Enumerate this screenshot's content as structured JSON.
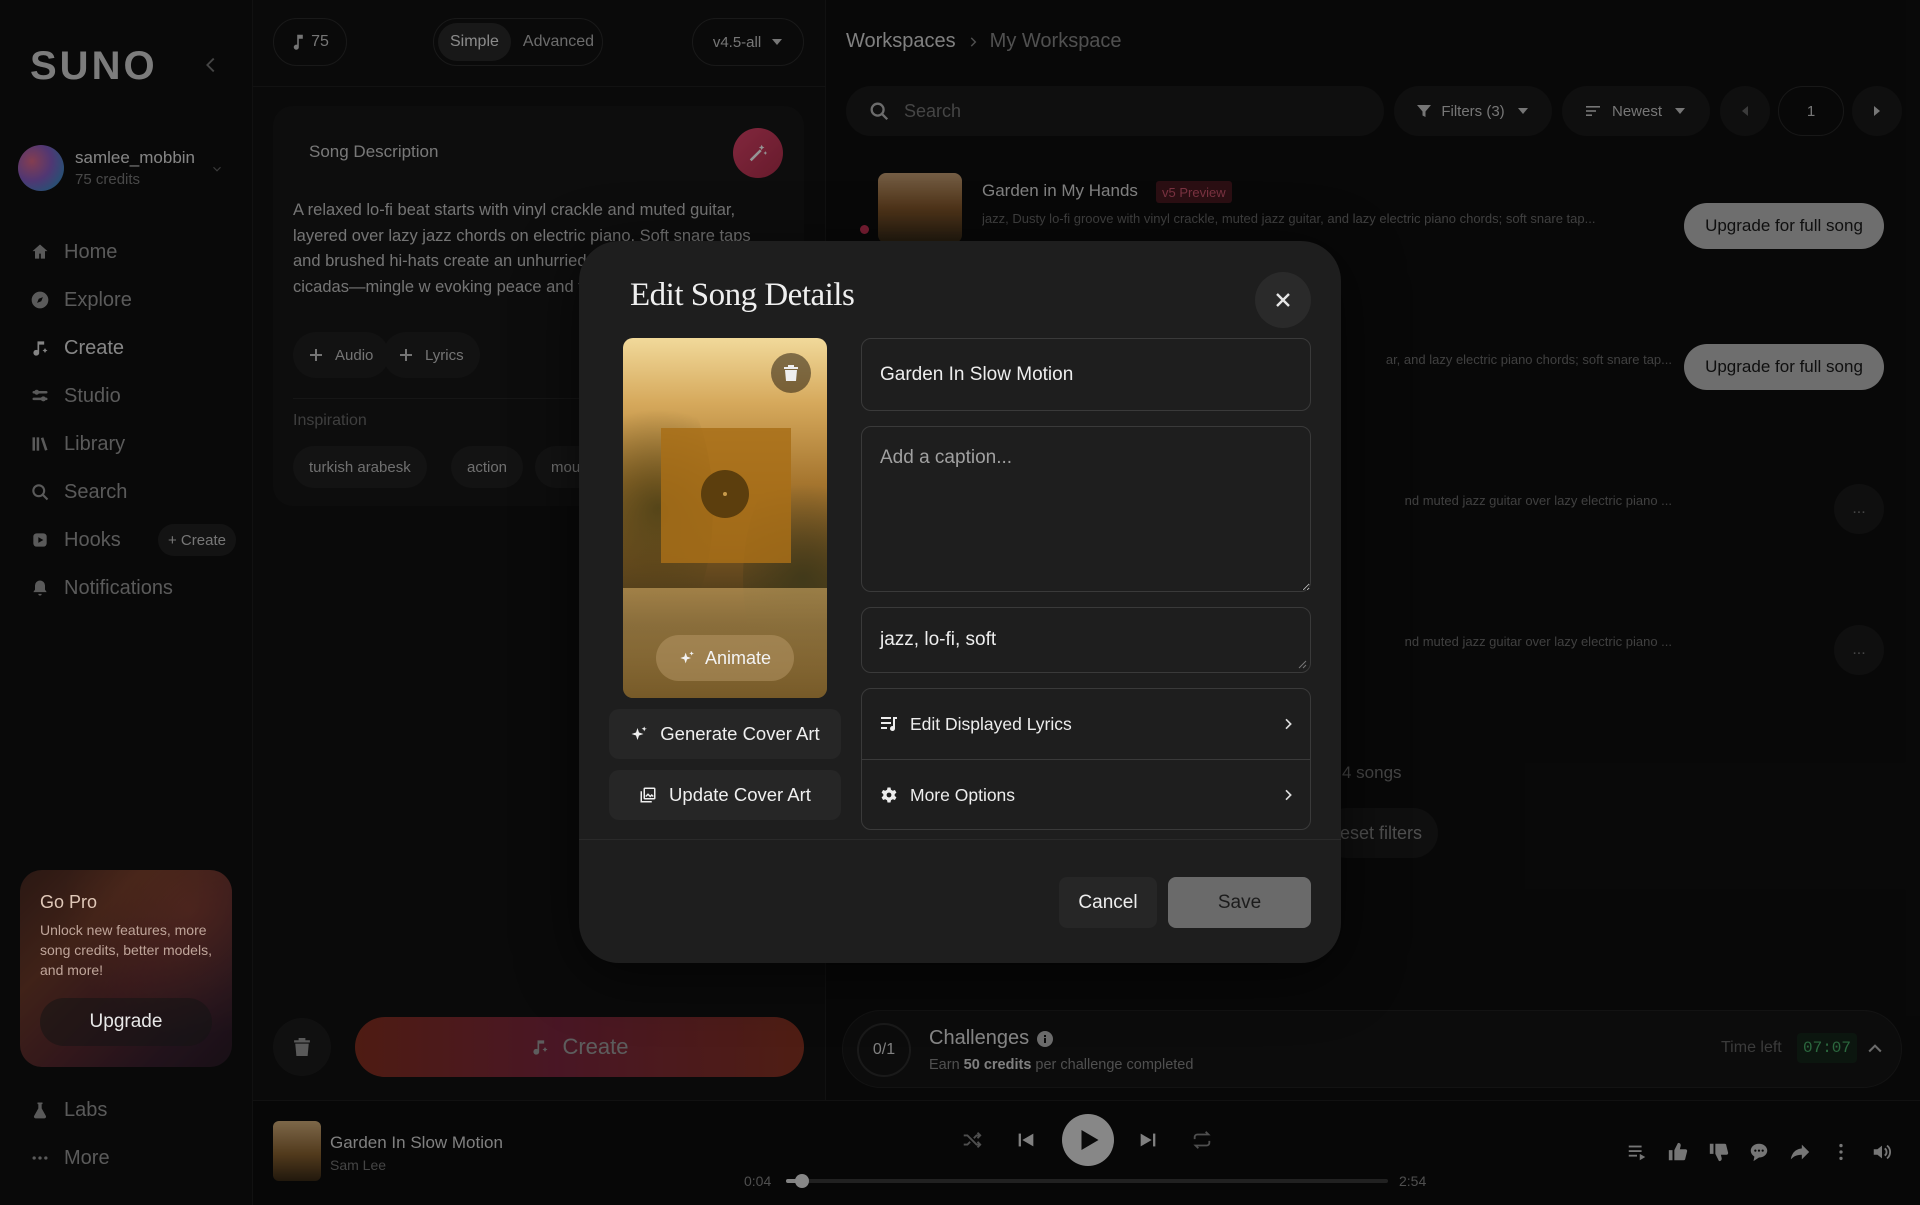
{
  "sidebar": {
    "logo": "SUNO",
    "user": {
      "name": "samlee_mobbin",
      "credits": "75 credits"
    },
    "nav": [
      {
        "label": "Home",
        "icon": "home-icon"
      },
      {
        "label": "Explore",
        "icon": "compass-icon"
      },
      {
        "label": "Create",
        "icon": "music-note-icon",
        "active": true
      },
      {
        "label": "Studio",
        "icon": "sliders-icon"
      },
      {
        "label": "Library",
        "icon": "library-icon"
      },
      {
        "label": "Search",
        "icon": "search-icon"
      },
      {
        "label": "Hooks",
        "icon": "hooks-icon",
        "action": "+ Create"
      },
      {
        "label": "Notifications",
        "icon": "bell-icon"
      }
    ],
    "go_pro": {
      "title": "Go Pro",
      "text": "Unlock new features, more song credits, better models, and more!",
      "button": "Upgrade"
    },
    "bottom_nav": [
      {
        "label": "Labs",
        "icon": "flask-icon"
      },
      {
        "label": "More",
        "icon": "more-icon"
      }
    ]
  },
  "create_panel": {
    "credits": "75",
    "modes": [
      "Simple",
      "Advanced"
    ],
    "selected_mode": "Simple",
    "version": "v4.5-all",
    "description_label": "Song Description",
    "description_text": "A relaxed lo-fi beat starts with vinyl crackle and muted guitar, layered over lazy jazz chords on electric piano. Soft snare taps and brushed hi-hats create an unhurried —birds and distant cicadas—mingle w evoking peace and focus for gardenin",
    "audio_button": "Audio",
    "lyrics_button": "Lyrics",
    "inspiration_label": "Inspiration",
    "inspiration_tags": [
      "turkish arabesk",
      "action",
      "mouth"
    ],
    "create_button": "Create"
  },
  "workspace": {
    "breadcrumb": {
      "root": "Workspaces",
      "current": "My Workspace"
    },
    "search_placeholder": "Search",
    "filters": "Filters (3)",
    "sort": "Newest",
    "page": "1",
    "songs": [
      {
        "title": "Garden in My Hands",
        "badge": "v5 Preview",
        "description": "jazz, Dusty lo-fi groove with vinyl crackle, muted jazz guitar, and lazy electric piano chords; soft snare tap...",
        "action": "Upgrade for full song"
      },
      {
        "description": "ar, and lazy electric piano chords; soft snare tap...",
        "action": "Upgrade for full song"
      },
      {
        "description": "nd muted jazz guitar over lazy electric piano ...",
        "action": "..."
      },
      {
        "description": "nd muted jazz guitar over lazy electric piano ...",
        "action": "..."
      }
    ],
    "songs_count": "4 songs",
    "reset_filters": "eset filters",
    "challenges": {
      "progress": "0/1",
      "title": "Challenges",
      "sub_prefix": "Earn ",
      "sub_bold": "50 credits",
      "sub_suffix": " per challenge completed",
      "time_label": "Time left",
      "time_value": "07:07"
    }
  },
  "player": {
    "title": "Garden In Slow Motion",
    "artist": "Sam Lee",
    "current_time": "0:04",
    "duration": "2:54",
    "progress": 0.026
  },
  "modal": {
    "title": "Edit Song Details",
    "animate": "Animate",
    "generate_cover": "Generate Cover Art",
    "update_cover": "Update Cover Art",
    "song_title": "Garden In Slow Motion",
    "caption_placeholder": "Add a caption...",
    "tags": "jazz, lo-fi, soft",
    "edit_lyrics": "Edit Displayed Lyrics",
    "more_options": "More Options",
    "cancel": "Cancel",
    "save": "Save"
  }
}
